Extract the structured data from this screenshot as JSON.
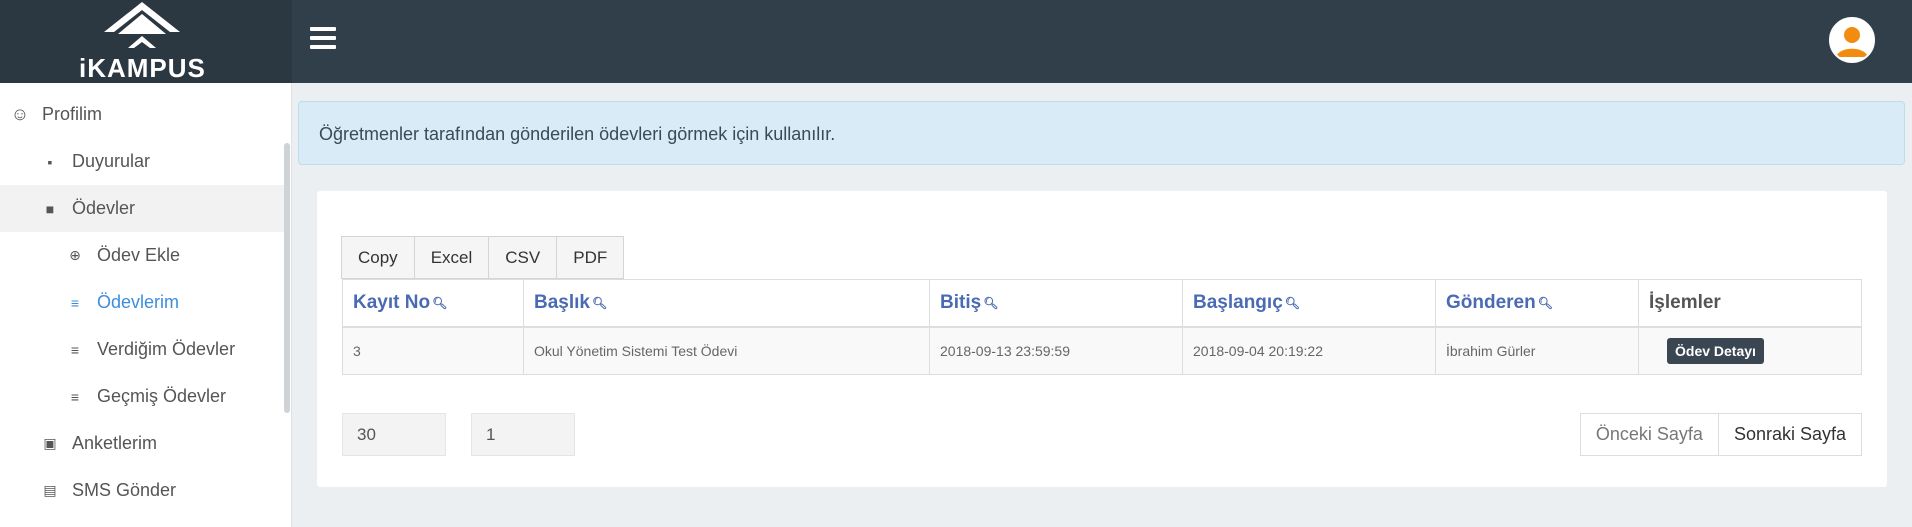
{
  "brand": {
    "logo_text": "iKAMPUS"
  },
  "sidebar": {
    "items": [
      {
        "label": "Profilim",
        "icon": "face-icon"
      },
      {
        "label": "Duyurular",
        "icon": "message-icon"
      },
      {
        "label": "Ödevler",
        "icon": "briefcase-icon"
      },
      {
        "label": "Ödev Ekle",
        "icon": "plus-circle-icon"
      },
      {
        "label": "Ödevlerim",
        "icon": "list-icon"
      },
      {
        "label": "Verdiğim Ödevler",
        "icon": "list-icon"
      },
      {
        "label": "Geçmiş Ödevler",
        "icon": "list-icon"
      },
      {
        "label": "Anketlerim",
        "icon": "poll-icon"
      },
      {
        "label": "SMS Gönder",
        "icon": "sim-card-icon"
      }
    ]
  },
  "callout": {
    "text": "Öğretmenler tarafından gönderilen ödevleri görmek için kullanılır."
  },
  "export_buttons": [
    "Copy",
    "Excel",
    "CSV",
    "PDF"
  ],
  "table": {
    "headers": [
      "Kayıt No",
      "Başlık",
      "Bitiş",
      "Başlangıç",
      "Gönderen",
      "İşlemler"
    ],
    "rows": [
      {
        "id": "3",
        "title": "Okul Yönetim Sistemi Test Ödevi",
        "end": "2018-09-13 23:59:59",
        "start": "2018-09-04 20:19:22",
        "sender": "İbrahim Gürler",
        "action": "Ödev Detayı"
      }
    ]
  },
  "paging": {
    "page_size": "30",
    "page_number": "1",
    "prev_label": "Önceki Sayfa",
    "next_label": "Sonraki Sayfa"
  },
  "colors": {
    "topbar": "#313f4a",
    "accent_blue": "#3c8dde",
    "header_link": "#4a6bb3",
    "avatar_orange": "#f28c0f"
  }
}
